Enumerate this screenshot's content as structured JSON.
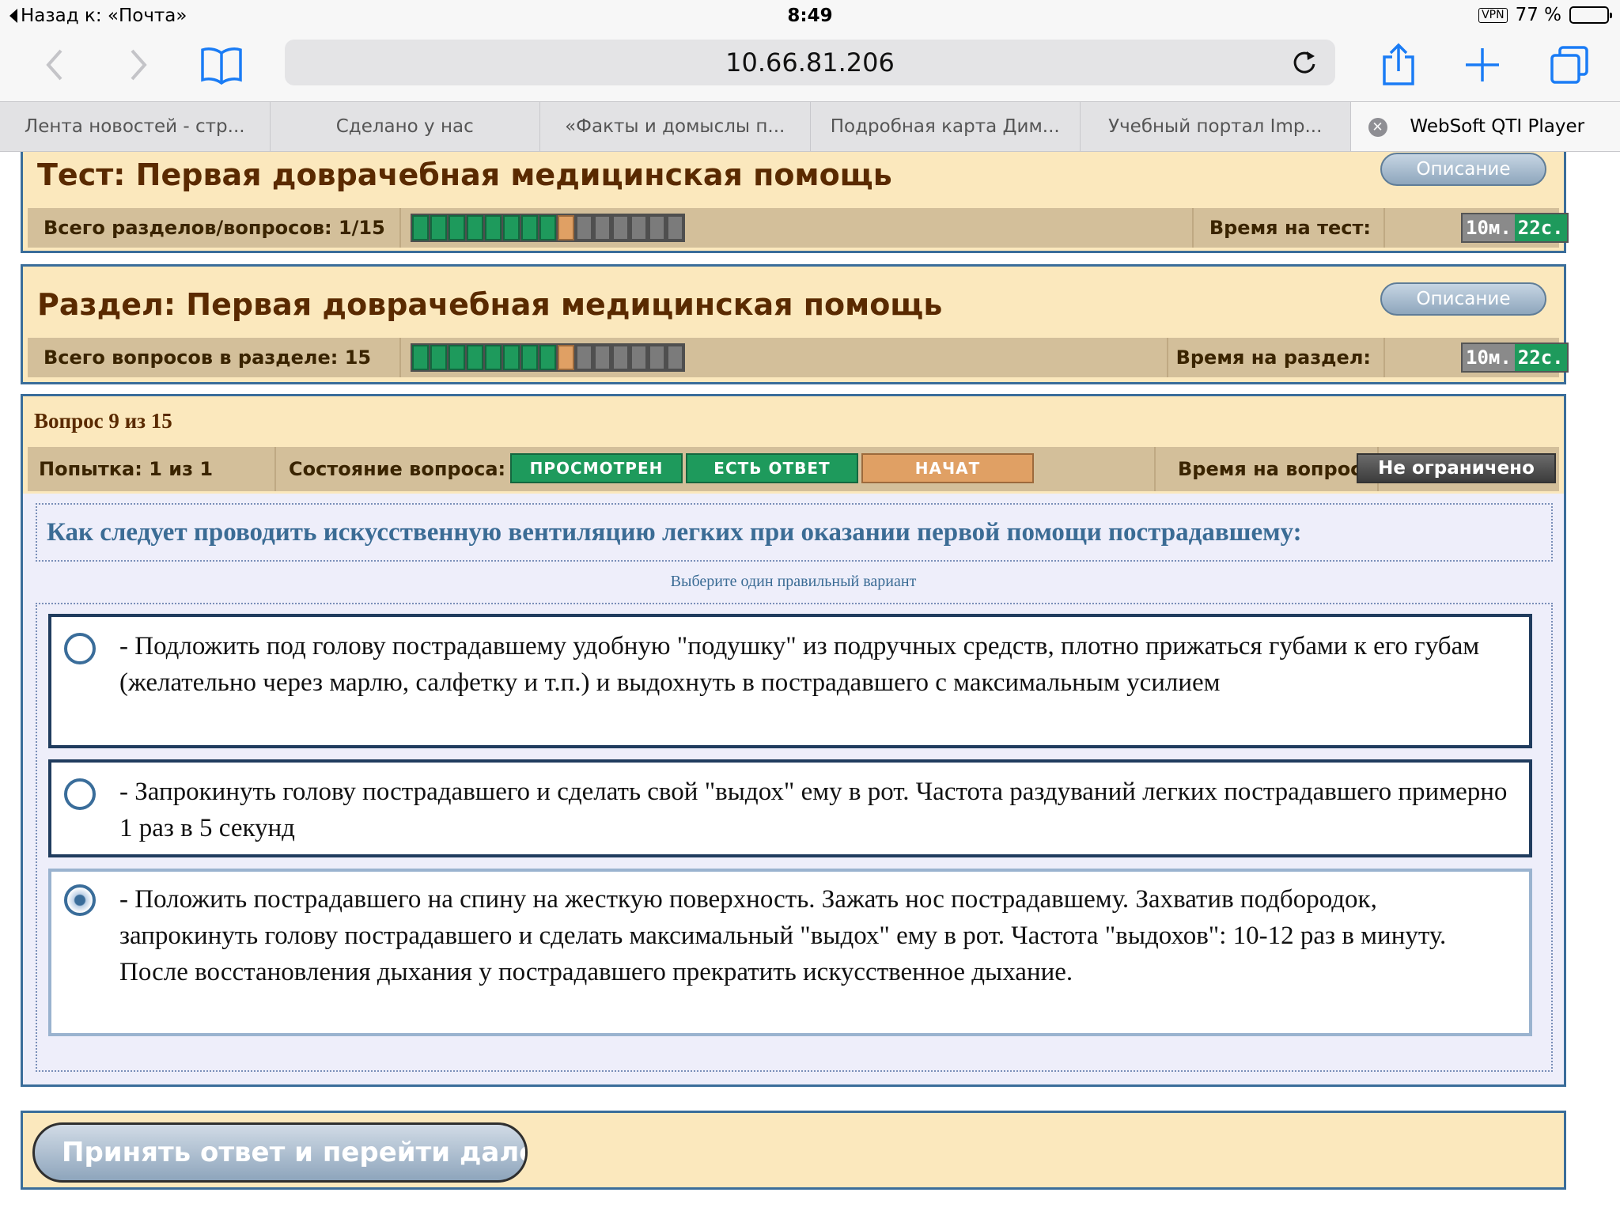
{
  "status": {
    "back": "Назад к: «Почта»",
    "time": "8:49",
    "vpn": "VPN",
    "battery": "77 %",
    "battery_level": 0.77
  },
  "browser": {
    "url": "10.66.81.206"
  },
  "tabs": [
    {
      "label": "Лента новостей - стр..."
    },
    {
      "label": "Сделано у нас"
    },
    {
      "label": "«Факты и домыслы п..."
    },
    {
      "label": "Подробная карта Дим..."
    },
    {
      "label": "Учебный портал Imp..."
    },
    {
      "label": "WebSoft QTI Player"
    }
  ],
  "test": {
    "title": "Тест: Первая доврачебная медицинская помощь",
    "desc_button": "Описание",
    "sections_label": "Всего разделов/вопросов: 1/15",
    "progress": {
      "done": 8,
      "current": 1,
      "todo": 6
    },
    "time_label": "Время на тест:",
    "time_min": "10м.",
    "time_sec": "22с."
  },
  "section": {
    "title": "Раздел: Первая доврачебная медицинская помощь",
    "desc_button": "Описание",
    "questions_label": "Всего вопросов в разделе: 15",
    "progress": {
      "done": 8,
      "current": 1,
      "todo": 6
    },
    "time_label": "Время на раздел:",
    "time_min": "10м.",
    "time_sec": "22с."
  },
  "question": {
    "number": "Вопрос 9 из 15",
    "attempt": "Попытка: 1 из 1",
    "state_label": "Состояние вопроса:",
    "states": [
      "ПРОСМОТРЕН",
      "ЕСТЬ ОТВЕТ",
      "НАЧАТ"
    ],
    "time_label": "Время на вопрос:",
    "time_value": "Не ограничено",
    "text": "Как следует проводить искусственную вентиляцию легких при оказании первой помощи пострадавшему:",
    "instruction": "Выберите один правильный вариант",
    "options": [
      {
        "text": "- Подложить под голову пострадавшему удобную \"подушку\" из подручных средств, плотно прижаться губами к его губам (желательно через марлю, салфетку и т.п.) и выдохнуть в пострадавшего с максимальным усилием",
        "selected": false
      },
      {
        "text": "- Запрокинуть голову пострадавшего и сделать свой \"выдох\" ему в рот. Частота раздуваний легких пострадавшего примерно 1 раз в 5 секунд",
        "selected": false
      },
      {
        "text": "- Положить пострадавшего на спину на жесткую поверхность. Зажать нос пострадавшему. Захватив подбородок, запрокинуть голову пострадавшего и сделать максимальный \"выдох\" ему в рот. Частота \"выдохов\": 10-12 раз в минуту. После восстановления дыхания у пострадавшего прекратить искусственное дыхание.",
        "selected": true
      }
    ]
  },
  "submit_button": "Принять ответ и перейти далее"
}
